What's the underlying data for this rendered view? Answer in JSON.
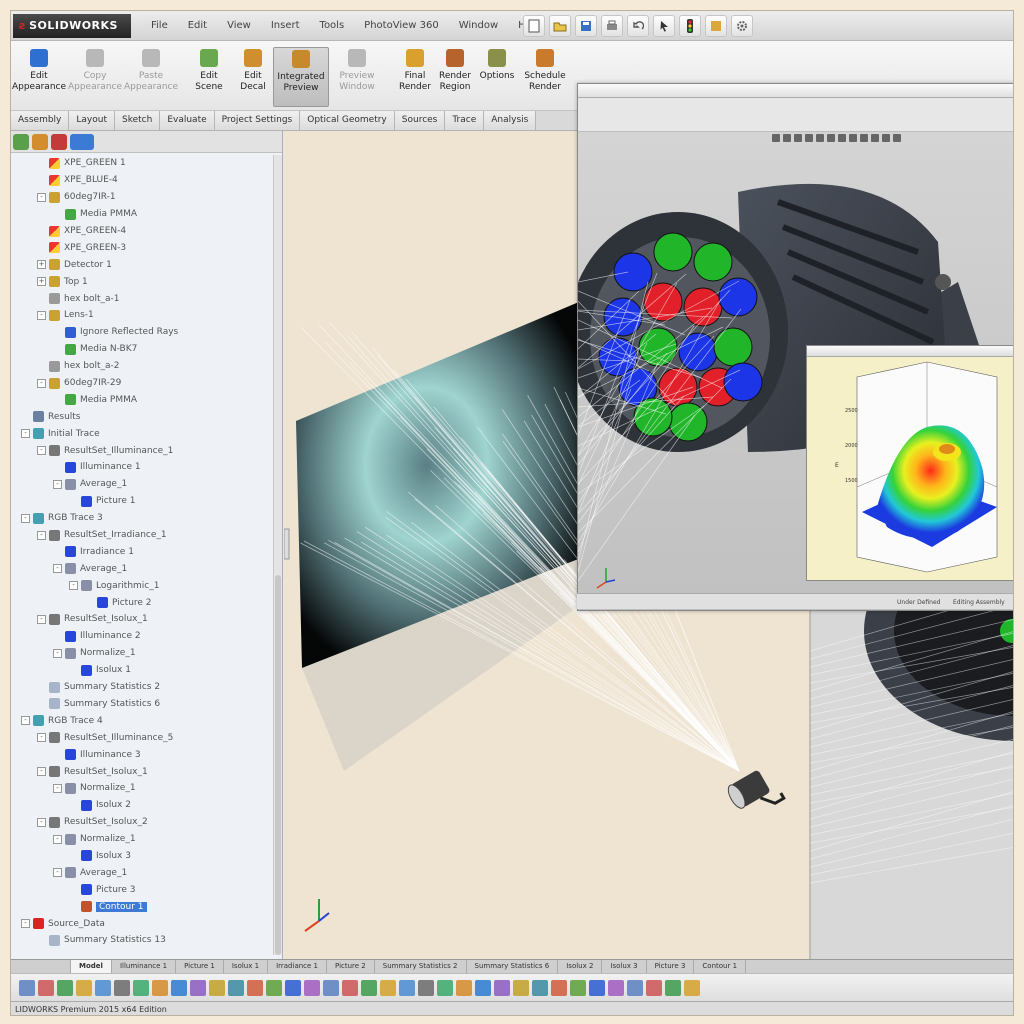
{
  "app": {
    "logo_text": "SOLIDWORKS",
    "status_text": "LIDWORKS Premium 2015 x64 Edition"
  },
  "menus": [
    "File",
    "Edit",
    "View",
    "Insert",
    "Tools",
    "PhotoView 360",
    "Window",
    "Help"
  ],
  "ribbon": {
    "buttons": [
      {
        "label": "Edit\nAppearance",
        "state": "normal",
        "color": "#2f6fd0"
      },
      {
        "label": "Copy\nAppearance",
        "state": "disabled",
        "color": "#b8b8b8"
      },
      {
        "label": "Paste\nAppearance",
        "state": "disabled",
        "color": "#b8b8b8"
      },
      {
        "label": "Edit\nScene",
        "state": "normal",
        "color": "#6aa84f"
      },
      {
        "label": "Edit\nDecal",
        "state": "normal",
        "color": "#cf8f2e"
      },
      {
        "label": "Integrated\nPreview",
        "state": "active",
        "color": "#c68a2a"
      },
      {
        "label": "Preview\nWindow",
        "state": "disabled",
        "color": "#b8b8b8"
      },
      {
        "label": "Final\nRender",
        "state": "normal",
        "color": "#d9a02d"
      },
      {
        "label": "Render\nRegion",
        "state": "normal",
        "color": "#b7632e"
      },
      {
        "label": "Options",
        "state": "normal",
        "color": "#8a8f4a"
      },
      {
        "label": "Schedule\nRender",
        "state": "normal",
        "color": "#c97b2b"
      }
    ]
  },
  "tabs": [
    "Assembly",
    "Layout",
    "Sketch",
    "Evaluate",
    "Project Settings",
    "Optical Geometry",
    "Sources",
    "Trace",
    "Analysis"
  ],
  "tree": {
    "nodes": [
      {
        "label": "XPE_GREEN 1",
        "indent": 1,
        "icon": "source",
        "exp": ""
      },
      {
        "label": "XPE_BLUE-4",
        "indent": 1,
        "icon": "source",
        "exp": ""
      },
      {
        "label": "60deg7IR-1",
        "indent": 1,
        "icon": "part",
        "exp": "-"
      },
      {
        "label": "Media PMMA",
        "indent": 2,
        "icon": "media",
        "exp": ""
      },
      {
        "label": "XPE_GREEN-4",
        "indent": 1,
        "icon": "source",
        "exp": ""
      },
      {
        "label": "XPE_GREEN-3",
        "indent": 1,
        "icon": "source",
        "exp": ""
      },
      {
        "label": "Detector 1",
        "indent": 1,
        "icon": "part",
        "exp": "+"
      },
      {
        "label": "Top 1",
        "indent": 1,
        "icon": "part",
        "exp": "+"
      },
      {
        "label": "hex bolt_a-1",
        "indent": 1,
        "icon": "bolt",
        "exp": ""
      },
      {
        "label": "Lens-1",
        "indent": 1,
        "icon": "part",
        "exp": "-"
      },
      {
        "label": "Ignore Reflected Rays",
        "indent": 2,
        "icon": "ray",
        "exp": ""
      },
      {
        "label": "Media N-BK7",
        "indent": 2,
        "icon": "media",
        "exp": ""
      },
      {
        "label": "hex bolt_a-2",
        "indent": 1,
        "icon": "bolt",
        "exp": ""
      },
      {
        "label": "60deg7IR-29",
        "indent": 1,
        "icon": "part",
        "exp": "-"
      },
      {
        "label": "Media PMMA",
        "indent": 2,
        "icon": "media",
        "exp": ""
      },
      {
        "label": "Results",
        "indent": 0,
        "icon": "results",
        "exp": ""
      },
      {
        "label": "Initial Trace",
        "indent": 0,
        "icon": "trace",
        "exp": "-"
      },
      {
        "label": "ResultSet_Illuminance_1",
        "indent": 1,
        "icon": "resultset",
        "exp": "-"
      },
      {
        "label": "Illuminance 1",
        "indent": 2,
        "icon": "plot",
        "exp": ""
      },
      {
        "label": "Average_1",
        "indent": 2,
        "icon": "filter",
        "exp": "-"
      },
      {
        "label": "Picture 1",
        "indent": 3,
        "icon": "plot",
        "exp": ""
      },
      {
        "label": "RGB Trace 3",
        "indent": 0,
        "icon": "trace",
        "exp": "-"
      },
      {
        "label": "ResultSet_Irradiance_1",
        "indent": 1,
        "icon": "resultset",
        "exp": "-"
      },
      {
        "label": "Irradiance 1",
        "indent": 2,
        "icon": "plot",
        "exp": ""
      },
      {
        "label": "Average_1",
        "indent": 2,
        "icon": "filter",
        "exp": "-"
      },
      {
        "label": "Logarithmic_1",
        "indent": 3,
        "icon": "filter",
        "exp": "-"
      },
      {
        "label": "Picture 2",
        "indent": 4,
        "icon": "plot",
        "exp": ""
      },
      {
        "label": "ResultSet_Isolux_1",
        "indent": 1,
        "icon": "resultset",
        "exp": "-"
      },
      {
        "label": "Illuminance 2",
        "indent": 2,
        "icon": "plot",
        "exp": ""
      },
      {
        "label": "Normalize_1",
        "indent": 2,
        "icon": "filter",
        "exp": "-"
      },
      {
        "label": "Isolux 1",
        "indent": 3,
        "icon": "plot",
        "exp": ""
      },
      {
        "label": "Summary Statistics 2",
        "indent": 1,
        "icon": "stats",
        "exp": ""
      },
      {
        "label": "Summary Statistics 6",
        "indent": 1,
        "icon": "stats",
        "exp": ""
      },
      {
        "label": "RGB Trace 4",
        "indent": 0,
        "icon": "trace",
        "exp": "-"
      },
      {
        "label": "ResultSet_Illuminance_5",
        "indent": 1,
        "icon": "resultset",
        "exp": "-"
      },
      {
        "label": "Illuminance 3",
        "indent": 2,
        "icon": "plot",
        "exp": ""
      },
      {
        "label": "ResultSet_Isolux_1",
        "indent": 1,
        "icon": "resultset",
        "exp": "-"
      },
      {
        "label": "Normalize_1",
        "indent": 2,
        "icon": "filter",
        "exp": "-"
      },
      {
        "label": "Isolux 2",
        "indent": 3,
        "icon": "plot",
        "exp": ""
      },
      {
        "label": "ResultSet_Isolux_2",
        "indent": 1,
        "icon": "resultset",
        "exp": "-"
      },
      {
        "label": "Normalize_1",
        "indent": 2,
        "icon": "filter",
        "exp": "-"
      },
      {
        "label": "Isolux 3",
        "indent": 3,
        "icon": "plot",
        "exp": ""
      },
      {
        "label": "Average_1",
        "indent": 2,
        "icon": "filter",
        "exp": "-"
      },
      {
        "label": "Picture 3",
        "indent": 3,
        "icon": "plot",
        "exp": ""
      },
      {
        "label": "Contour 1",
        "indent": 3,
        "icon": "contour",
        "exp": "",
        "selected": true
      },
      {
        "label": "Source_Data",
        "indent": 0,
        "icon": "source_data",
        "exp": "-"
      },
      {
        "label": "Summary Statistics 13",
        "indent": 1,
        "icon": "stats",
        "exp": ""
      }
    ]
  },
  "bottom_tabs": [
    "Model",
    "Illuminance 1",
    "Picture 1",
    "Isolux 1",
    "Irradiance 1",
    "Picture 2",
    "Summary Statistics 2",
    "Summary Statistics 6",
    "Isolux 2",
    "Isolux 3",
    "Picture 3",
    "Contour 1"
  ],
  "preview": {
    "status_left": "Under Defined",
    "status_right": "Editing Assembly"
  },
  "colors": {
    "accent": "#3d7ad6",
    "led_red": "#e2202a",
    "led_green": "#21b52a",
    "led_blue": "#1c35e6",
    "housing": "#3a3f48",
    "viewport_bg": "#efe4d2"
  }
}
